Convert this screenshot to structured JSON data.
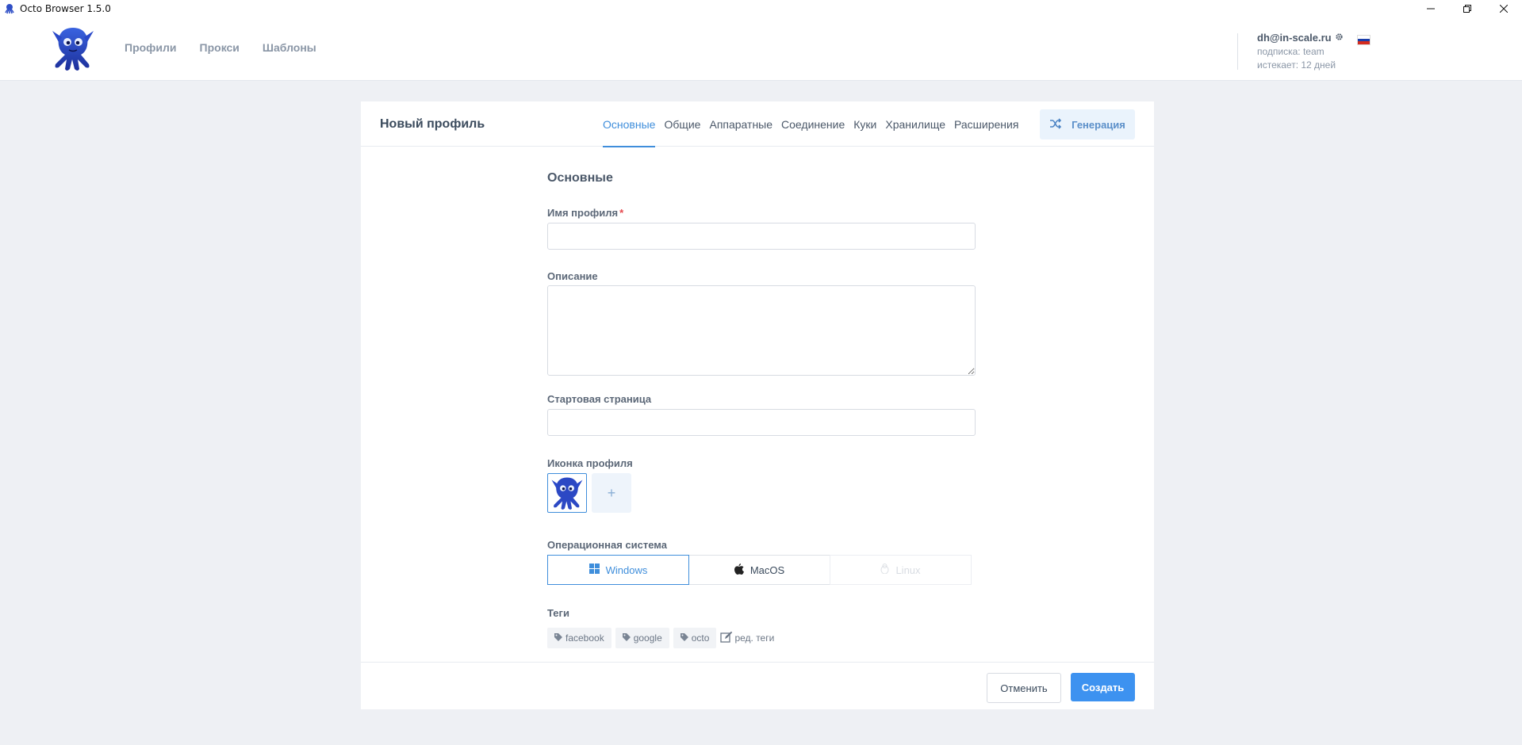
{
  "window": {
    "title": "Octo Browser 1.5.0",
    "app_icon": "octopus-icon",
    "controls": [
      "minimize-icon",
      "restore-icon",
      "close-icon"
    ]
  },
  "header": {
    "logo": "octopus-logo",
    "nav": [
      "Профили",
      "Прокси",
      "Шаблоны"
    ],
    "account": {
      "email": "dh@in-scale.ru",
      "subscription": "подписка: team",
      "expires": "истекает: 12 дней",
      "settings_icon": "gear-icon",
      "language_flag": "russian-flag-icon"
    }
  },
  "card": {
    "title": "Новый профиль",
    "tabs": [
      "Основные",
      "Общие",
      "Аппаратные",
      "Соединение",
      "Куки",
      "Хранилище",
      "Расширения"
    ],
    "active_tab": "Основные",
    "generate_button": "Генерация",
    "generate_icon": "shuffle-icon"
  },
  "form": {
    "section_title": "Основные",
    "profile_name_label": "Имя профиля",
    "profile_name_required": "*",
    "profile_name_value": "",
    "description_label": "Описание",
    "description_value": "",
    "start_page_label": "Стартовая страница",
    "start_page_value": "",
    "profile_icon_label": "Иконка профиля",
    "add_icon_label": "+",
    "os_label": "Операционная система",
    "os_options": [
      "Windows",
      "MacOS",
      "Linux"
    ],
    "os_selected": "Windows",
    "tags_label": "Теги",
    "tags": [
      "facebook",
      "google",
      "octo"
    ],
    "edit_tags_label": "ред. теги"
  },
  "footer": {
    "cancel": "Отменить",
    "create": "Создать"
  },
  "colors": {
    "accent": "#3f8edb",
    "primary_button": "#3d92f0",
    "background": "#eef0f4"
  }
}
